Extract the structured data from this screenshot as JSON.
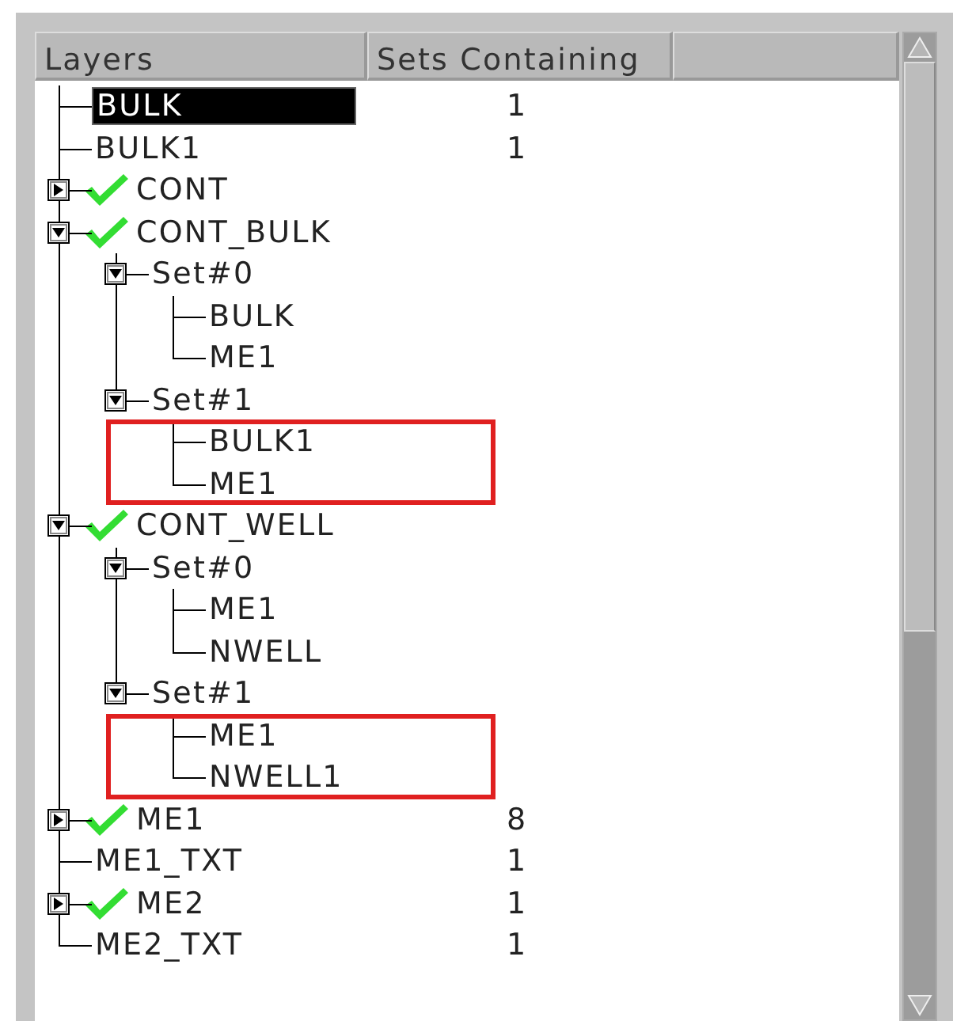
{
  "columns": [
    "Layers",
    "Sets Containing"
  ],
  "tree": [
    {
      "label": "BULK",
      "count": "1",
      "selected": true,
      "checked": false
    },
    {
      "label": "BULK1",
      "count": "1",
      "selected": false,
      "checked": false
    },
    {
      "label": "CONT",
      "selected": false,
      "checked": true,
      "expanded": false
    },
    {
      "label": "CONT_BULK",
      "selected": false,
      "checked": true,
      "expanded": true,
      "children": [
        {
          "label": "Set#0",
          "selected": false,
          "expanded": true,
          "highlight_children": false,
          "children": [
            {
              "label": "BULK",
              "selected": false
            },
            {
              "label": "ME1",
              "selected": false
            }
          ]
        },
        {
          "label": "Set#1",
          "selected": false,
          "expanded": true,
          "highlight_children": true,
          "children": [
            {
              "label": "BULK1",
              "selected": false
            },
            {
              "label": "ME1",
              "selected": false
            }
          ]
        }
      ]
    },
    {
      "label": "CONT_WELL",
      "selected": false,
      "checked": true,
      "expanded": true,
      "children": [
        {
          "label": "Set#0",
          "selected": false,
          "expanded": true,
          "highlight_children": false,
          "children": [
            {
              "label": "ME1",
              "selected": false
            },
            {
              "label": "NWELL",
              "selected": false
            }
          ]
        },
        {
          "label": "Set#1",
          "selected": false,
          "expanded": true,
          "highlight_children": true,
          "children": [
            {
              "label": "ME1",
              "selected": false
            },
            {
              "label": "NWELL1",
              "selected": false
            }
          ]
        }
      ]
    },
    {
      "label": "ME1",
      "count": "8",
      "selected": false,
      "checked": true,
      "expanded": false
    },
    {
      "label": "ME1_TXT",
      "count": "1",
      "selected": false,
      "checked": false
    },
    {
      "label": "ME2",
      "count": "1",
      "selected": false,
      "checked": true,
      "expanded": false
    },
    {
      "label": "ME2_TXT",
      "count": "1",
      "selected": false,
      "checked": false
    }
  ]
}
